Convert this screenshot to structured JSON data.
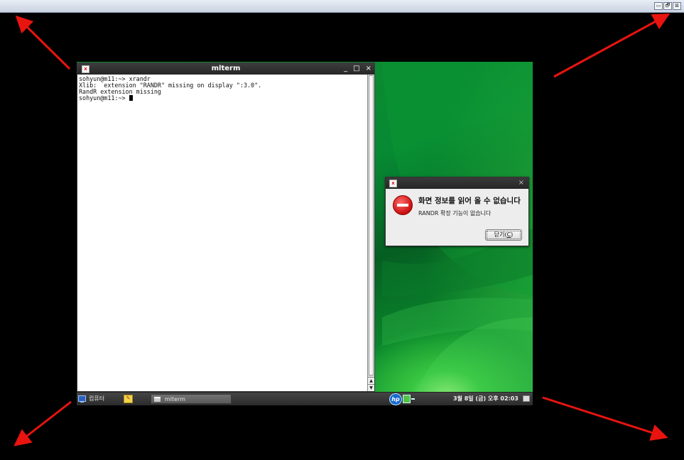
{
  "viewer": {
    "controls": [
      "▭",
      "🗗",
      "⊠"
    ]
  },
  "terminal": {
    "title": "mlterm",
    "buttons": [
      "_",
      "□",
      "×"
    ],
    "lines": [
      "sohyun@m11:~> xrandr",
      "Xlib:  extension \"RANDR\" missing on display \":3.0\".",
      "RandR extension missing",
      "sohyun@m11:~> "
    ],
    "scroll_up": "▲",
    "scroll_down": "▼"
  },
  "dialog": {
    "close": "×",
    "heading": "화면 정보를 읽어 올 수 없습니다",
    "message": "RANDR 확장 기능이 없습니다",
    "button_label": "닫기(",
    "button_mnemonic": "C",
    "button_suffix": ")"
  },
  "taskbar": {
    "start_label": "컴퓨터",
    "task_label": "mlterm",
    "hp_label": "hp",
    "clock": "3월 8일 (금) 오후 02:03"
  },
  "colors": {
    "arrow": "#e8140f",
    "desktop_green": "#078a34",
    "titlebar": "#2f2f2f"
  }
}
